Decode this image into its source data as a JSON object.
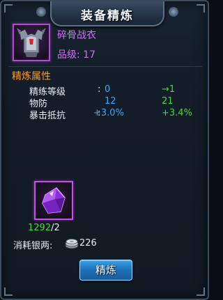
{
  "window": {
    "title": "装备精炼"
  },
  "item": {
    "icon": "armor-icon",
    "name": "碎骨战衣",
    "level_text": "品级: 17",
    "rarity_color": "#d26ff5"
  },
  "refine": {
    "section_title": "精炼属性",
    "stats": [
      {
        "label": "精练等级",
        "colon": ":",
        "current": "0",
        "next": "→1"
      },
      {
        "label": "物防",
        "colon": "",
        "current": "12",
        "next": "21"
      },
      {
        "label": "暴击抵抗",
        "colon": ":",
        "current": "+3.0%",
        "next": "+3.4%"
      }
    ]
  },
  "material": {
    "icon": "purple-crystal-icon",
    "have": "1292",
    "need": "/2"
  },
  "cost": {
    "label": "消耗银两:",
    "icon": "silver-coin-icon",
    "value": "226"
  },
  "button": {
    "label": "精炼"
  },
  "colors": {
    "current_value": "#3aa9ff",
    "next_value": "#46d838",
    "section_title": "#ff9a1f"
  }
}
